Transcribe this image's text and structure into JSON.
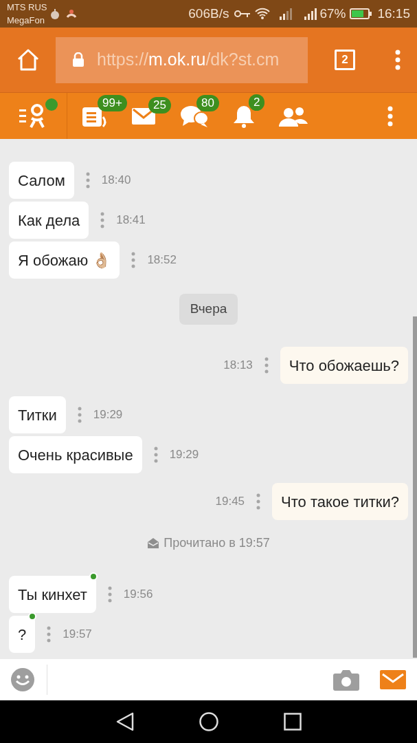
{
  "status_bar": {
    "carrier_1": "MTS RUS",
    "carrier_2": "MegaFon",
    "speed": "606B/s",
    "battery": "67%",
    "time": "16:15"
  },
  "browser": {
    "url_scheme": "https://",
    "url_host": "m.ok.ru",
    "url_path": "/dk?st.cm",
    "tab_count": "2"
  },
  "nav": {
    "online": true,
    "badges": [
      {
        "kind": "feed",
        "count": "99+"
      },
      {
        "kind": "mail",
        "count": "25"
      },
      {
        "kind": "chat",
        "count": "80"
      },
      {
        "kind": "bell",
        "count": "2"
      },
      {
        "kind": "friends"
      }
    ]
  },
  "messages": [
    {
      "kind": "incoming",
      "text": "Салом",
      "time": "18:40",
      "online": false
    },
    {
      "kind": "incoming",
      "text": "Как дела",
      "time": "18:41",
      "online": false
    },
    {
      "kind": "incoming",
      "text": "Я обожаю 👌🏼",
      "time": "18:52",
      "online": false
    },
    {
      "kind": "date",
      "text": "Вчера"
    },
    {
      "kind": "outgoing",
      "text": "Что обожаешь?",
      "time": "18:13"
    },
    {
      "kind": "incoming",
      "text": "Титки",
      "time": "19:29",
      "online": false
    },
    {
      "kind": "incoming",
      "text": "Очень красивые",
      "time": "19:29",
      "online": false
    },
    {
      "kind": "outgoing",
      "text": "Что такое титки?",
      "time": "19:45"
    },
    {
      "kind": "read",
      "text": "Прочитано в 19:57"
    },
    {
      "kind": "incoming",
      "text": "Ты кинхет",
      "time": "19:56",
      "online": true
    },
    {
      "kind": "incoming",
      "text": "?",
      "time": "19:57",
      "online": true
    }
  ]
}
